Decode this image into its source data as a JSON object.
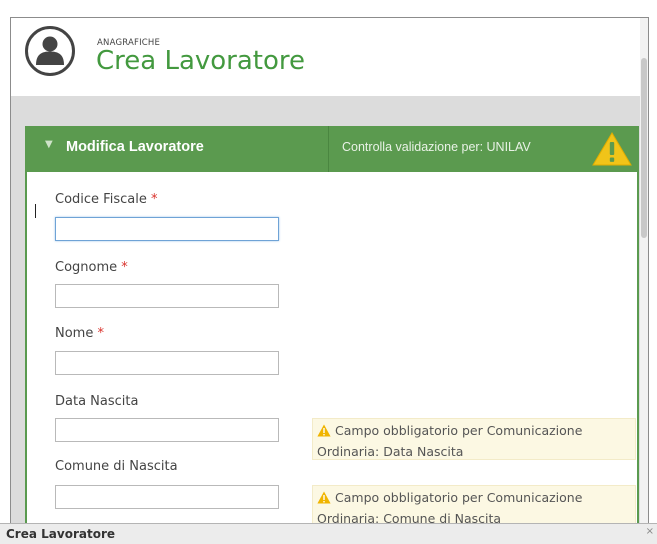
{
  "header": {
    "eyebrow": "ANAGRAFICHE",
    "title": "Crea Lavoratore",
    "icon": "user-avatar-icon"
  },
  "panel": {
    "caret": "▼",
    "title": "Modifica Lavoratore",
    "validation_text": "Controlla validazione per: UNILAV",
    "warning_icon": "warning-triangle-icon"
  },
  "form": {
    "fields": [
      {
        "label": "Codice Fiscale",
        "required": "*",
        "value": "",
        "placeholder": ""
      },
      {
        "label": "Cognome",
        "required": "*",
        "value": "",
        "placeholder": ""
      },
      {
        "label": "Nome",
        "required": "*",
        "value": "",
        "placeholder": ""
      },
      {
        "label": "Data Nascita",
        "required": "",
        "value": "",
        "placeholder": ""
      },
      {
        "label": "Comune di Nascita",
        "required": "",
        "value": "",
        "placeholder": ""
      }
    ],
    "notices": [
      {
        "text": "Campo obbligatorio per Comunicazione Ordinaria: Data Nascita"
      },
      {
        "text": "Campo obbligatorio per Comunicazione Ordinaria: Comune di Nascita"
      }
    ]
  },
  "statusbar": {
    "label": "Crea Lavoratore",
    "close": "×"
  },
  "colors": {
    "accent_green": "#43993f",
    "panel_header": "#5b9a4f",
    "warning_yellow": "#f0c419",
    "notice_bg": "#fcf8e3",
    "required_red": "#d9312b"
  }
}
